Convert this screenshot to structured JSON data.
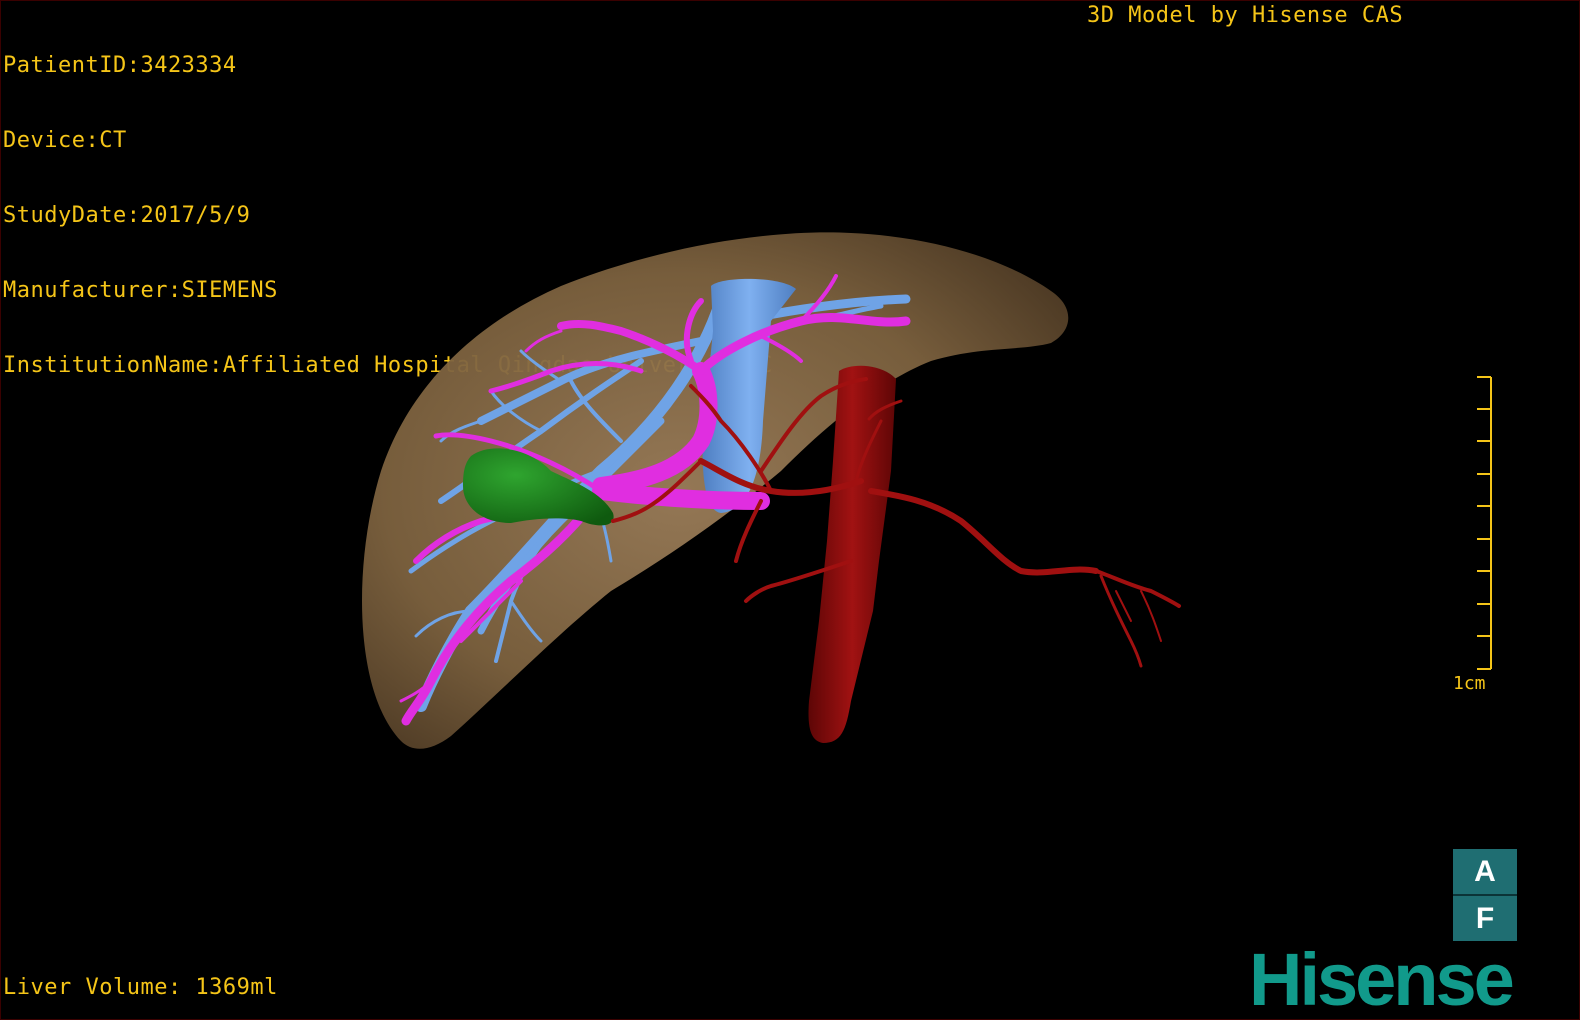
{
  "header": {
    "patient_id": "PatientID:3423334",
    "device": "Device:CT",
    "study_date": "StudyDate:2017/5/9",
    "manufacturer": "Manufacturer:SIEMENS",
    "institution": "InstitutionName:Affiliated Hospital Qingdao University-C"
  },
  "credit": "3D Model by Hisense CAS",
  "footer": {
    "liver_volume": "Liver Volume: 1369ml"
  },
  "scale_bar": {
    "label": "1cm",
    "color": "#f5c518"
  },
  "orientation": {
    "top_label": "A",
    "bottom_label": "F",
    "color": "#1f6e72"
  },
  "brand": {
    "name": "Hisense",
    "color": "#119a8b"
  },
  "colors": {
    "text": "#f5c518",
    "liver": "#8a6d4c",
    "portal_vein": "#e02ee0",
    "hepatic_vein": "#6fa3e6",
    "artery": "#a01010",
    "gallbladder": "#1f8a1f"
  }
}
